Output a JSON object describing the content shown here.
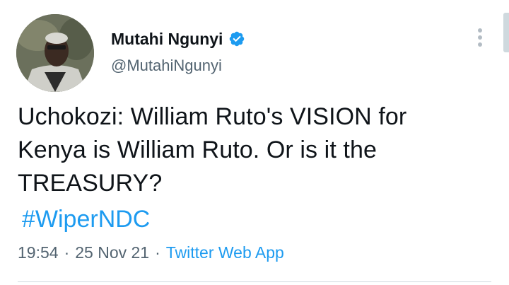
{
  "author": {
    "display_name": "Mutahi Ngunyi",
    "handle": "@MutahiNgunyi",
    "verified": true
  },
  "tweet": {
    "text_lines": [
      "Uchokozi: William Ruto's VISION for",
      "Kenya is William Ruto. Or is it the",
      "TREASURY?"
    ],
    "hashtag": "#WiperNDC"
  },
  "meta": {
    "time": "19:54",
    "separator": "·",
    "date": "25 Nov 21",
    "source": "Twitter Web App"
  },
  "icons": {
    "verified": "verified-badge-icon",
    "more": "more-vertical-icon"
  },
  "colors": {
    "link": "#1d9bf0",
    "secondary_text": "#536471",
    "primary_text": "#0f1419"
  }
}
